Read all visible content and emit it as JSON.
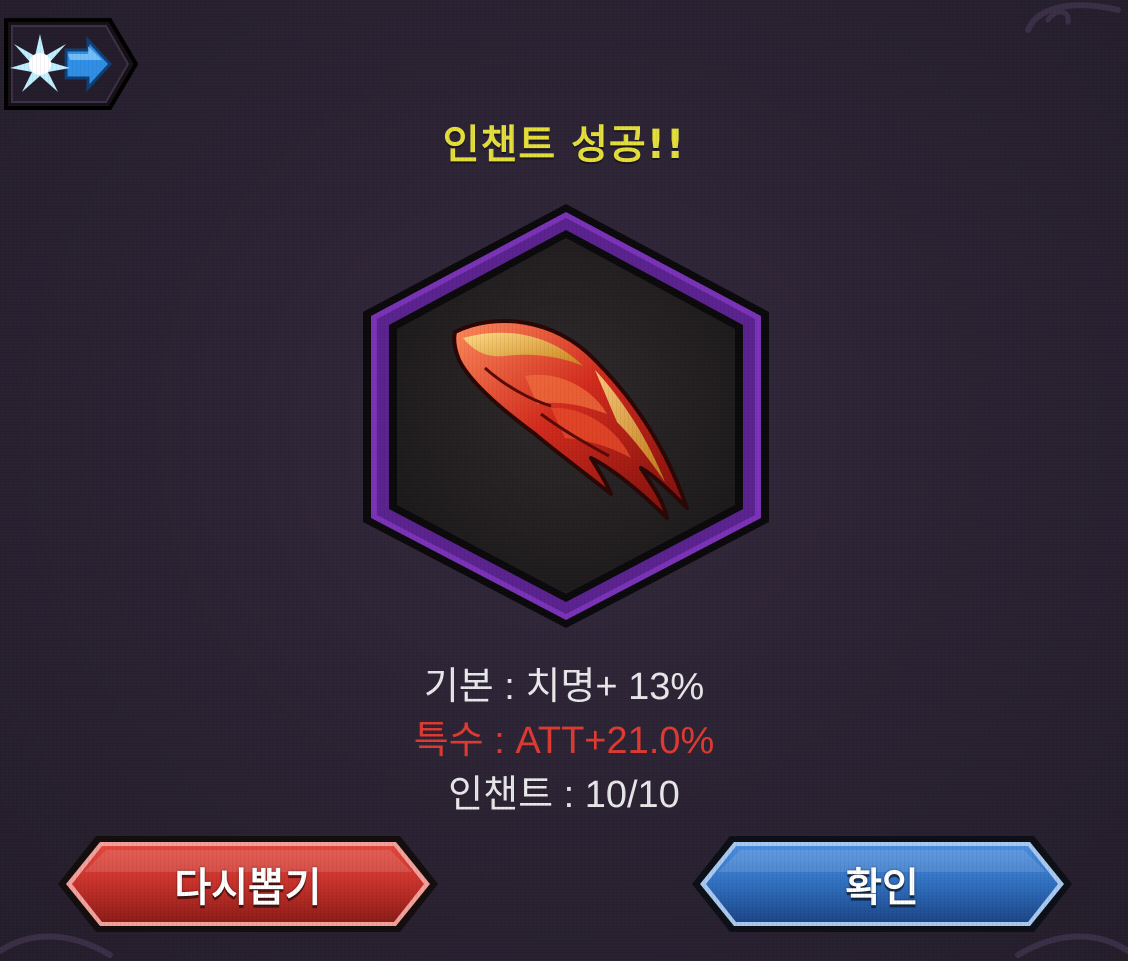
{
  "title": "인챈트 성공!!",
  "item": {
    "icon": "red-claw-blade-icon",
    "frame_color": "#7a33b8"
  },
  "stats": {
    "base": "기본 : 치명+ 13%",
    "special": "특수 : ATT+21.0%",
    "enchant": "인챈트 : 10/10"
  },
  "buttons": {
    "redraw_label": "다시뽑기",
    "confirm_label": "확인"
  },
  "colors": {
    "title": "#e3de3a",
    "special_stat": "#e03a30",
    "redraw_button": "#c8302a",
    "confirm_button": "#2f6fc0"
  }
}
